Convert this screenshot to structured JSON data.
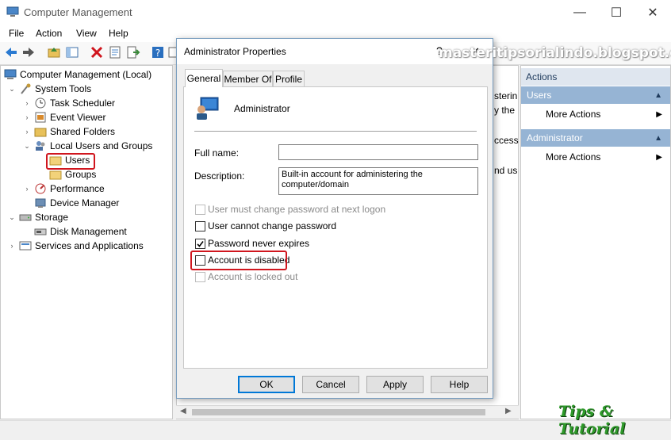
{
  "window": {
    "title": "Computer Management",
    "minimize": "—",
    "maximize": "☐",
    "close": "✕"
  },
  "menu": [
    "File",
    "Action",
    "View",
    "Help"
  ],
  "tree": {
    "root": "Computer Management (Local)",
    "system_tools": "System Tools",
    "task_scheduler": "Task Scheduler",
    "event_viewer": "Event Viewer",
    "shared_folders": "Shared Folders",
    "local_users_groups": "Local Users and Groups",
    "users": "Users",
    "groups": "Groups",
    "performance": "Performance",
    "device_manager": "Device Manager",
    "storage": "Storage",
    "disk_management": "Disk Management",
    "services_apps": "Services and Applications"
  },
  "center_fragments": [
    "sterin",
    "y the",
    "ccess",
    "nd us"
  ],
  "actions": {
    "header": "Actions",
    "sections": [
      {
        "title": "Users",
        "item": "More Actions"
      },
      {
        "title": "Administrator",
        "item": "More Actions"
      }
    ]
  },
  "dialog": {
    "title": "Administrator Properties",
    "help_glyph": "?",
    "close_glyph": "✕",
    "tabs": [
      "General",
      "Member Of",
      "Profile"
    ],
    "user_name": "Administrator",
    "full_name_label": "Full name:",
    "full_name_value": "",
    "description_label": "Description:",
    "description_value": "Built-in account for administering the computer/domain",
    "checkboxes": [
      {
        "label": "User must change password at next logon",
        "checked": false,
        "enabled": false
      },
      {
        "label": "User cannot change password",
        "checked": false,
        "enabled": true
      },
      {
        "label": "Password never expires",
        "checked": true,
        "enabled": true
      },
      {
        "label": "Account is disabled",
        "checked": false,
        "enabled": true
      },
      {
        "label": "Account is locked out",
        "checked": false,
        "enabled": false
      }
    ],
    "buttons": [
      "OK",
      "Cancel",
      "Apply",
      "Help"
    ]
  },
  "watermark": "masteritipsorialindo.blogspot.com",
  "logo_text": "Tips & Tutorial",
  "colors": {
    "highlight_red": "#d0161e",
    "actions_section": "#96b4d4",
    "accent_blue": "#0078d7"
  }
}
